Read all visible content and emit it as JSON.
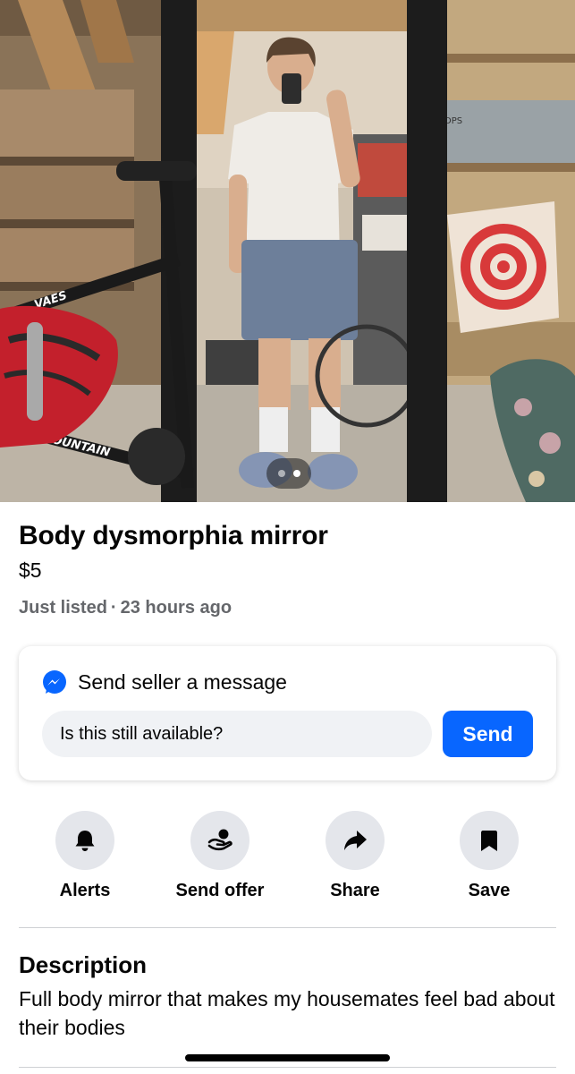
{
  "listing": {
    "title": "Body dysmorphia mirror",
    "price": "$5",
    "listed_status": "Just listed",
    "separator": "·",
    "listed_time": "23 hours ago"
  },
  "photo": {
    "description_icon": "listing-photo",
    "carousel": {
      "count": 2,
      "active_index": 1
    },
    "visible_text": {
      "bike_frame_top": "VAES",
      "bike_frame_bottom": "MOUNTAIN",
      "shelf_box": "DPS"
    }
  },
  "message_card": {
    "icon": "messenger-icon",
    "heading": "Send seller a message",
    "input_value": "Is this still available?",
    "send_label": "Send",
    "accent_color": "#0866ff"
  },
  "actions": [
    {
      "icon": "bell-icon",
      "label": "Alerts"
    },
    {
      "icon": "hand-dollar-icon",
      "label": "Send offer"
    },
    {
      "icon": "share-arrow-icon",
      "label": "Share"
    },
    {
      "icon": "bookmark-icon",
      "label": "Save"
    }
  ],
  "description": {
    "heading": "Description",
    "body": "Full body mirror that makes my housemates feel bad about their bodies"
  },
  "colors": {
    "secondary_text": "#65676b",
    "button_bg": "#e4e6eb",
    "input_bg": "#f0f2f5",
    "divider": "#ced0d4"
  }
}
